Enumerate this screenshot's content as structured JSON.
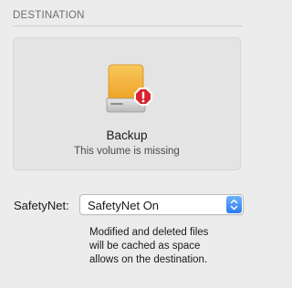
{
  "destination": {
    "section_title": "DESTINATION",
    "volume_name": "Backup",
    "volume_status": "This volume is missing",
    "drive_icon": "external-drive-icon",
    "warning_icon": "warning-badge-icon",
    "colors": {
      "drive_body": "#f4b33a",
      "warning_badge": "#d9242f"
    }
  },
  "safetynet": {
    "label": "SafetyNet:",
    "selected_value": "SafetyNet On",
    "stepper_icon": "chevron-up-down-icon",
    "help_lines": [
      "Modified and deleted files",
      "will be cached as space",
      "allows on the destination."
    ],
    "accent_color": "#2a7cf0"
  }
}
